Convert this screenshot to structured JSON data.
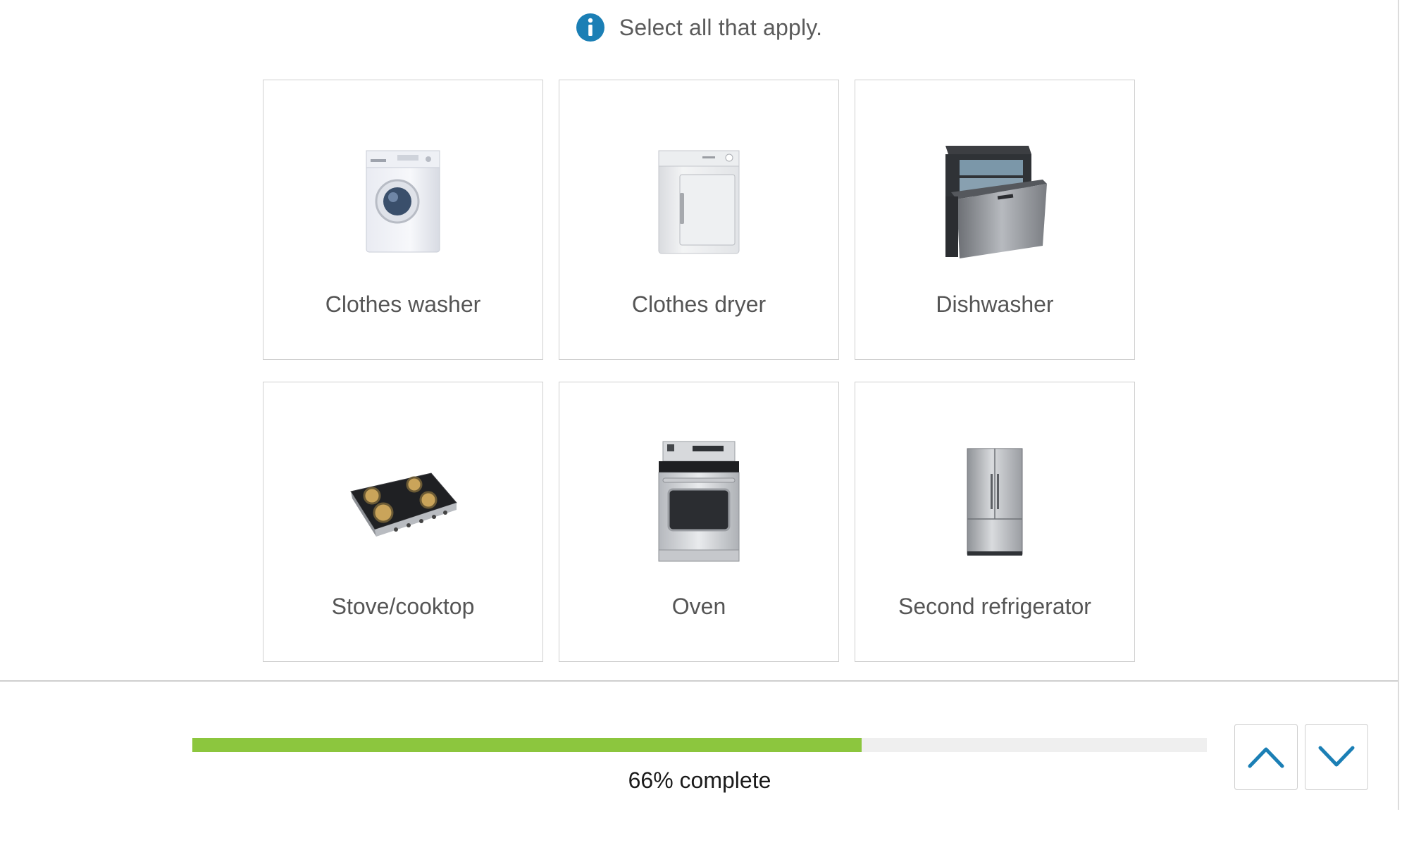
{
  "instruction": {
    "icon": "info-icon",
    "text": "Select all that apply."
  },
  "options": [
    {
      "label": "Clothes washer",
      "icon": "clothes-washer-icon"
    },
    {
      "label": "Clothes dryer",
      "icon": "clothes-dryer-icon"
    },
    {
      "label": "Dishwasher",
      "icon": "dishwasher-icon"
    },
    {
      "label": "Stove/cooktop",
      "icon": "stove-cooktop-icon"
    },
    {
      "label": "Oven",
      "icon": "oven-icon"
    },
    {
      "label": "Second refrigerator",
      "icon": "refrigerator-icon"
    }
  ],
  "progress": {
    "percent": 66,
    "label": "66% complete"
  },
  "navigation": {
    "up_icon": "chevron-up-icon",
    "down_icon": "chevron-down-icon"
  },
  "colors": {
    "accent": "#1b7fb5",
    "progress_fill": "#8cc63e",
    "progress_track": "#efefef",
    "tile_border": "#cfcfcf",
    "label_text": "#555555"
  }
}
